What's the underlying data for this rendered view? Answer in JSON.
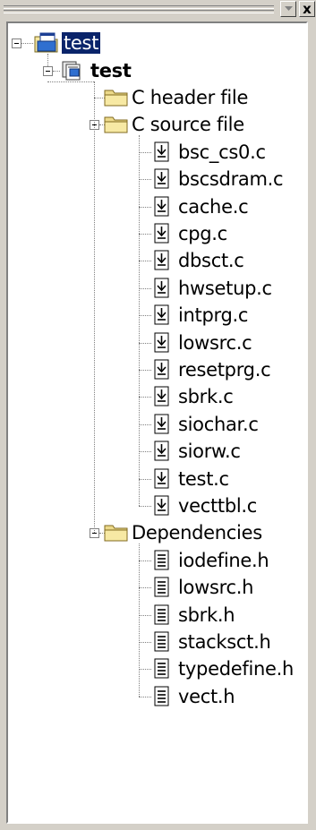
{
  "window": {
    "menu_button_icon": "chevron-down-icon",
    "close_button_label": "x"
  },
  "tree": {
    "workspace": {
      "label": "test",
      "icon": "workspace-icon",
      "selected": true
    },
    "project": {
      "label": "test",
      "icon": "project-icon"
    },
    "folders": [
      {
        "label": "C header file",
        "icon": "folder-icon",
        "expanded": false,
        "files": []
      },
      {
        "label": "C source file",
        "icon": "folder-icon",
        "expanded": true,
        "file_icon": "c-source-file-icon",
        "files": [
          "bsc_cs0.c",
          "bscsdram.c",
          "cache.c",
          "cpg.c",
          "dbsct.c",
          "hwsetup.c",
          "intprg.c",
          "lowsrc.c",
          "resetprg.c",
          "sbrk.c",
          "siochar.c",
          "siorw.c",
          "test.c",
          "vecttbl.c"
        ]
      },
      {
        "label": "Dependencies",
        "icon": "folder-icon",
        "expanded": true,
        "file_icon": "header-file-icon",
        "files": [
          "iodefine.h",
          "lowsrc.h",
          "sbrk.h",
          "stacksct.h",
          "typedefine.h",
          "vect.h"
        ]
      }
    ]
  }
}
